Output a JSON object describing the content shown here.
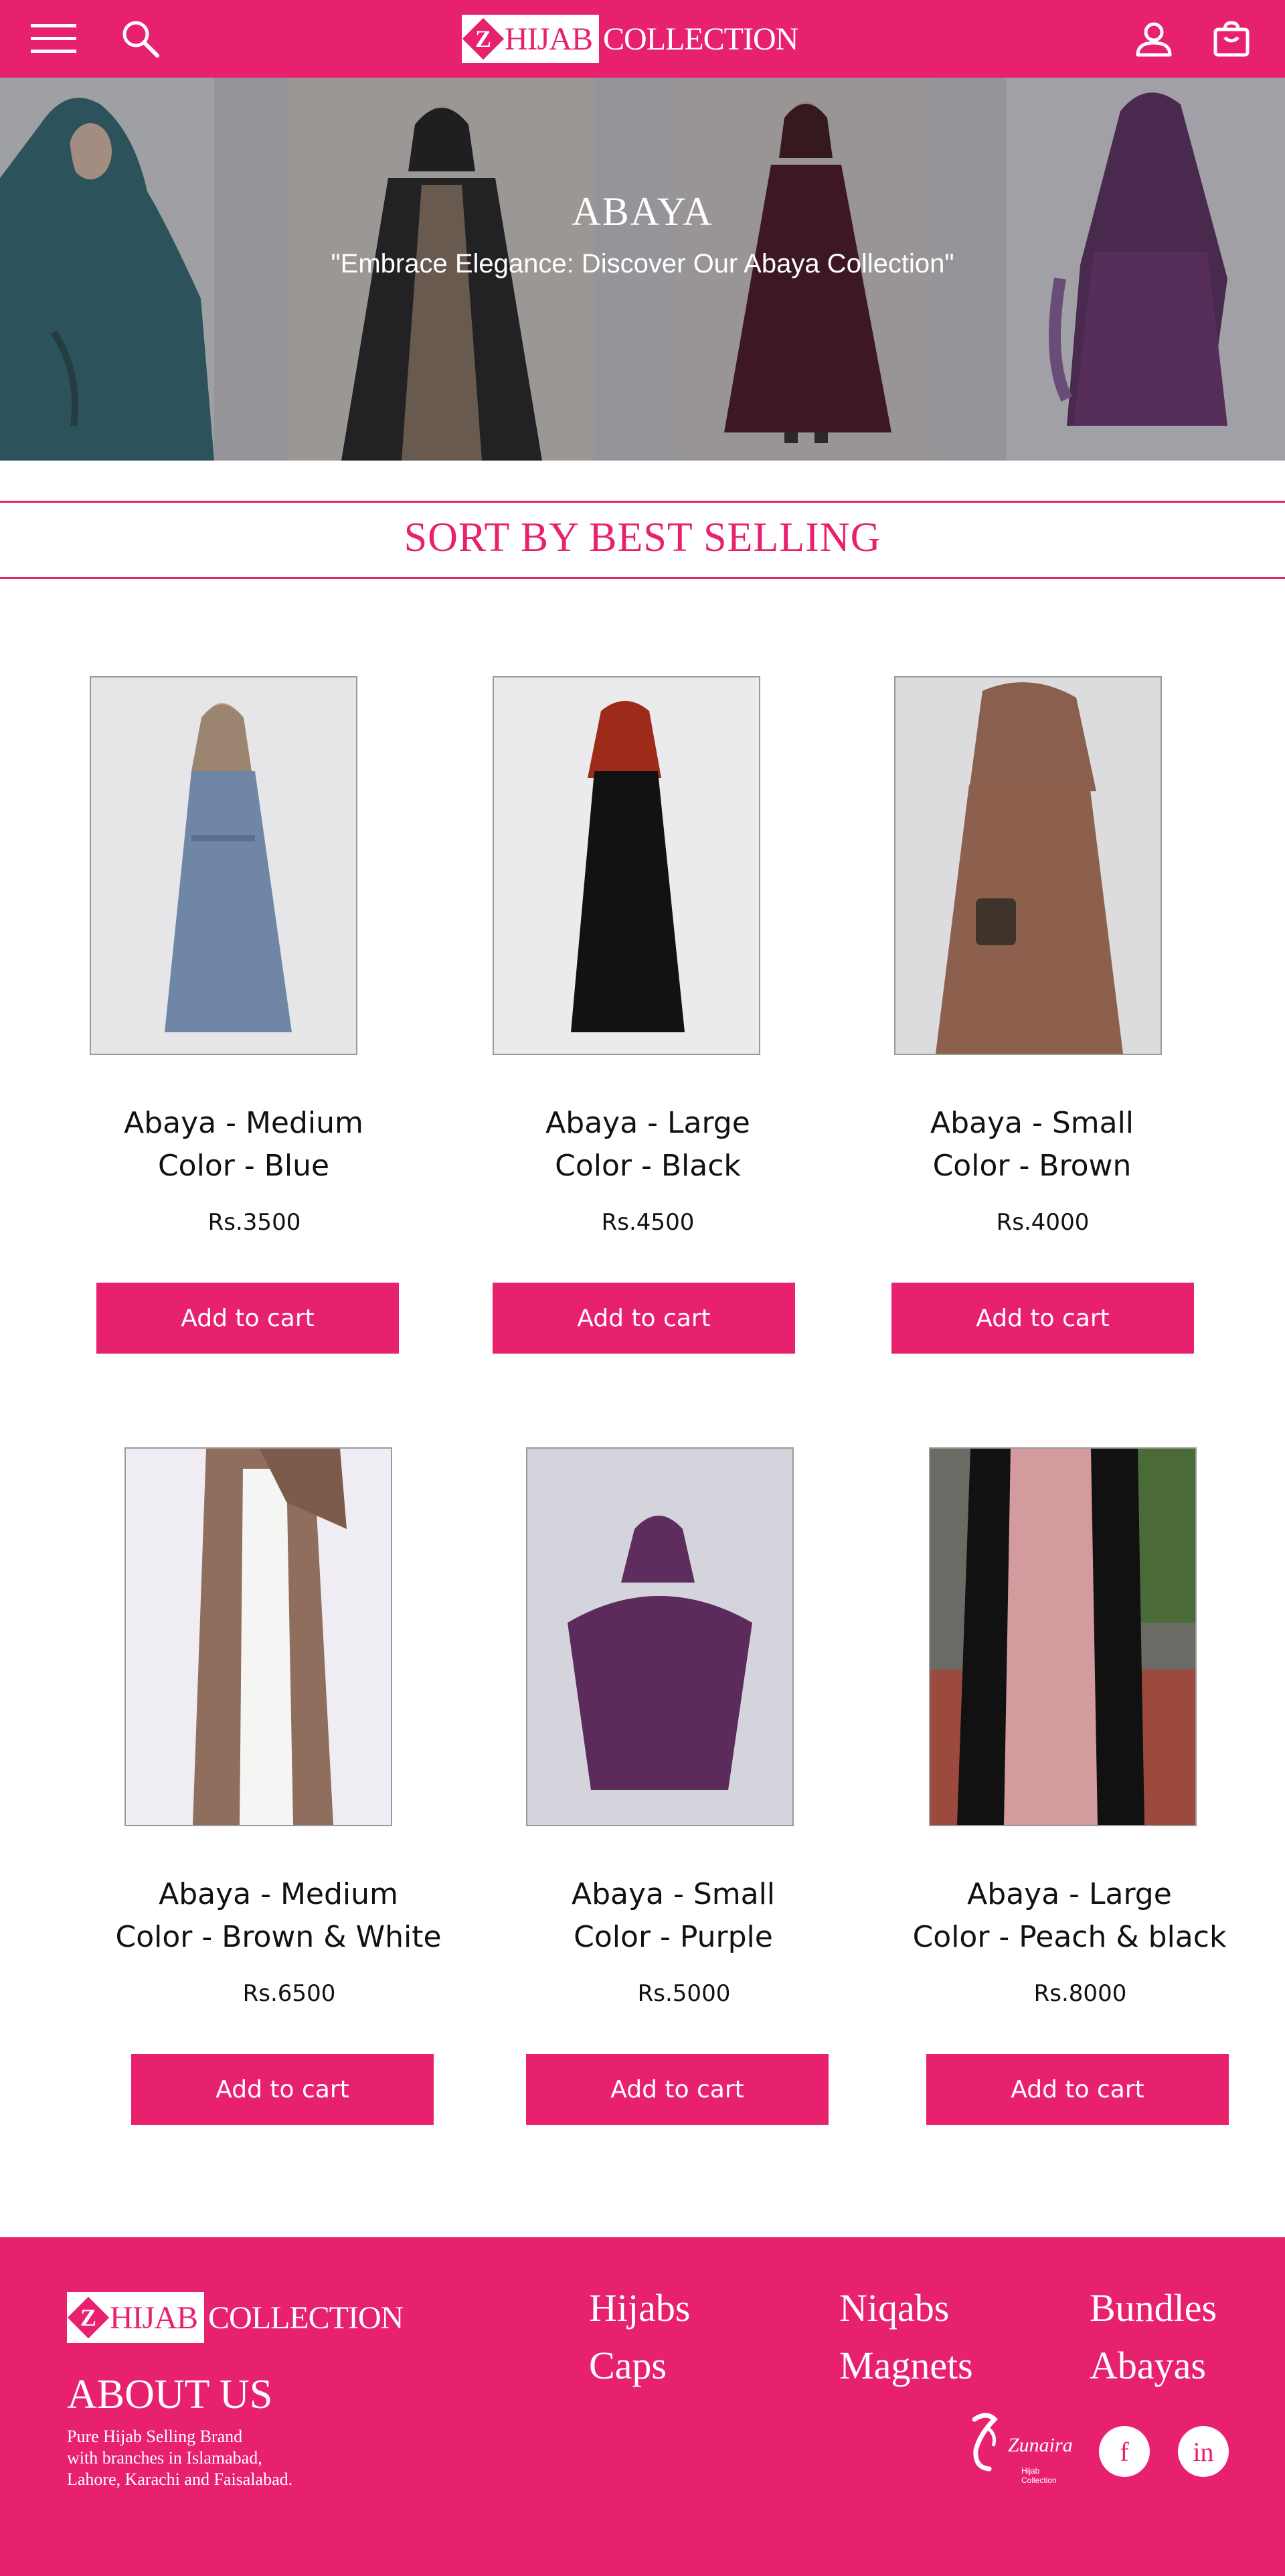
{
  "header": {
    "logo_part1": "HIJAB",
    "logo_part2": "COLLECTION",
    "logo_letter": "Z"
  },
  "hero": {
    "title": "ABAYA",
    "subtitle": "\"Embrace Elegance: Discover Our Abaya Collection\""
  },
  "sort": {
    "title": "SORT BY BEST SELLING"
  },
  "products": [
    {
      "line1": "Abaya - Medium",
      "line2": "Color - Blue",
      "price": "Rs.3500",
      "button": "Add to cart"
    },
    {
      "line1": "Abaya - Large",
      "line2": "Color - Black",
      "price": "Rs.4500",
      "button": "Add to cart"
    },
    {
      "line1": "Abaya - Small",
      "line2": "Color - Brown",
      "price": "Rs.4000",
      "button": "Add to cart"
    },
    {
      "line1": "Abaya - Medium",
      "line2": "Color - Brown & White",
      "price": "Rs.6500",
      "button": "Add to cart"
    },
    {
      "line1": "Abaya - Small",
      "line2": "Color - Purple",
      "price": "Rs.5000",
      "button": "Add to cart"
    },
    {
      "line1": "Abaya - Large",
      "line2": "Color - Peach & black",
      "price": "Rs.8000",
      "button": "Add to cart"
    }
  ],
  "footer": {
    "logo_part1": "HIJAB",
    "logo_part2": "COLLECTION",
    "logo_letter": "Z",
    "about_title": "ABOUT US",
    "about_line1": "Pure Hijab Selling Brand",
    "about_line2": "with branches in Islamabad,",
    "about_line3": "Lahore, Karachi and Faisalabad.",
    "links": [
      "Hijabs",
      "Niqabs",
      "Bundles",
      "Caps",
      "Magnets",
      "Abayas"
    ],
    "partner_name": "Zunaira",
    "partner_tag": "Hijab Collection",
    "social_facebook": "f",
    "social_linkedin": "in"
  },
  "colors": {
    "brand": "#e8216f",
    "white": "#ffffff"
  }
}
